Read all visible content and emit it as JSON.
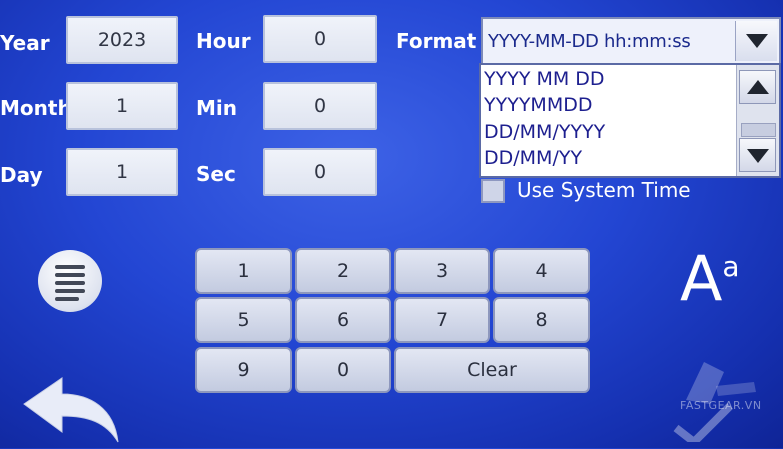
{
  "labels": {
    "year": "Year",
    "month": "Month",
    "day": "Day",
    "hour": "Hour",
    "min": "Min",
    "sec": "Sec",
    "format": "Format"
  },
  "fields": {
    "year": "2023",
    "month": "1",
    "day": "1",
    "hour": "0",
    "min": "0",
    "sec": "0"
  },
  "format_select": {
    "selected": "YYYY-MM-DD hh:mm:ss",
    "options": [
      "YYYY MM DD",
      "YYYYMMDD",
      "DD/MM/YYYY",
      "DD/MM/YY"
    ]
  },
  "use_system_time": {
    "label": "Use System Time",
    "checked": false
  },
  "keypad": {
    "keys": [
      "1",
      "2",
      "3",
      "4",
      "5",
      "6",
      "7",
      "8",
      "9",
      "0"
    ],
    "clear": "Clear"
  },
  "icons": {
    "menu": "menu-icon",
    "font": "font-size-icon",
    "back": "back-arrow-icon"
  },
  "font_icon": {
    "big": "A",
    "small": "a"
  },
  "watermark": "FASTGEAR.VN",
  "colors": {
    "background": "#2346d3",
    "label_text": "#ffffff",
    "field_bg": "#e8ecf6",
    "dropdown_text": "#1d1f8f"
  }
}
